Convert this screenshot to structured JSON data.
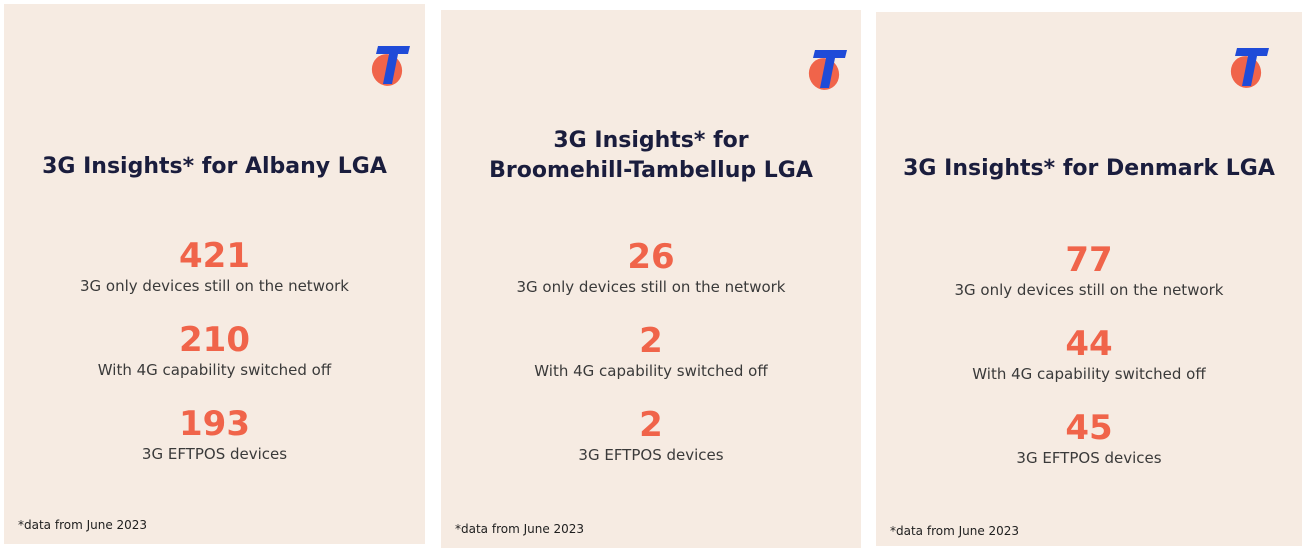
{
  "colors": {
    "card_background": "#f6ebe2",
    "accent": "#f0644a",
    "title_text": "#1a1d3d",
    "logo_blue": "#1f4bd8",
    "logo_orange": "#f0644a"
  },
  "cards": [
    {
      "logo_icon": "telstra-t-logo",
      "title_line1": "3G Insights* for Albany LGA",
      "title_line2": "",
      "stats": [
        {
          "value": "421",
          "label": "3G only devices still on the network"
        },
        {
          "value": "210",
          "label": "With 4G capability switched off"
        },
        {
          "value": "193",
          "label": "3G EFTPOS devices"
        }
      ],
      "footnote": "*data from June 2023"
    },
    {
      "logo_icon": "telstra-t-logo",
      "title_line1": "3G Insights* for",
      "title_line2": "Broomehill-Tambellup LGA",
      "stats": [
        {
          "value": "26",
          "label": "3G only devices still on the network"
        },
        {
          "value": "2",
          "label": "With 4G capability switched off"
        },
        {
          "value": "2",
          "label": "3G EFTPOS devices"
        }
      ],
      "footnote": "*data from June 2023"
    },
    {
      "logo_icon": "telstra-t-logo",
      "title_line1": "3G Insights* for Denmark LGA",
      "title_line2": "",
      "stats": [
        {
          "value": "77",
          "label": "3G only devices still on the network"
        },
        {
          "value": "44",
          "label": "With 4G capability switched off"
        },
        {
          "value": "45",
          "label": "3G EFTPOS devices"
        }
      ],
      "footnote": "*data from June 2023"
    }
  ]
}
